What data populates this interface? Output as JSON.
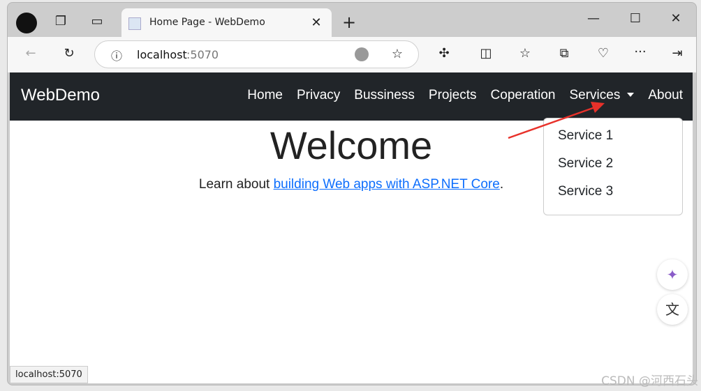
{
  "browser": {
    "tab_title": "Home Page - WebDemo",
    "address_host": "localhost",
    "address_port": ":5070",
    "status_url": "localhost:5070",
    "icons": [
      "profile-avatar",
      "workspaces-icon",
      "vertical-tabs-icon",
      "page-favicon",
      "close-tab-icon",
      "new-tab-icon",
      "minimize-icon",
      "maximize-icon",
      "close-window-icon",
      "back-icon",
      "refresh-icon",
      "info-icon",
      "edge-icon",
      "favorite-star-icon",
      "extensions-icon",
      "split-screen-icon",
      "favorites-icon",
      "collections-icon",
      "browser-essentials-icon",
      "more-icon",
      "sidebar-icon",
      "copilot-icon",
      "translate-icon"
    ]
  },
  "site": {
    "brand": "WebDemo",
    "nav": [
      "Home",
      "Privacy",
      "Bussiness",
      "Projects",
      "Coperation",
      "Services",
      "About"
    ],
    "dropdown": [
      "Service 1",
      "Service 2",
      "Service 3"
    ],
    "welcome": "Welcome",
    "learn_prefix": "Learn about ",
    "learn_link": "building Web apps with ASP.NET Core",
    "learn_suffix": "."
  },
  "annotation_color": "#e8312a",
  "watermark": "CSDN @河西石头"
}
